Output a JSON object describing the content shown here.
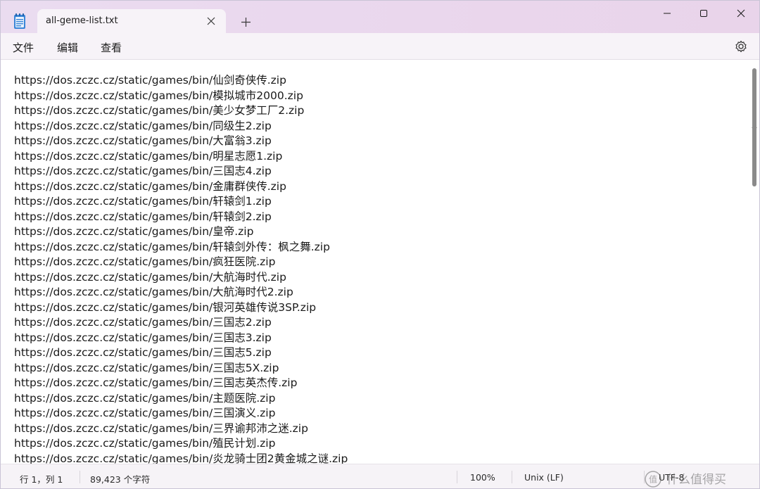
{
  "window": {
    "tab_title": "all-geme-list.txt",
    "new_tab_label": "+"
  },
  "menu": {
    "file": "文件",
    "edit": "编辑",
    "view": "查看"
  },
  "editor": {
    "lines": [
      "https://dos.zczc.cz/static/games/bin/仙剑奇侠传.zip",
      "https://dos.zczc.cz/static/games/bin/模拟城市2000.zip",
      "https://dos.zczc.cz/static/games/bin/美少女梦工厂2.zip",
      "https://dos.zczc.cz/static/games/bin/同级生2.zip",
      "https://dos.zczc.cz/static/games/bin/大富翁3.zip",
      "https://dos.zczc.cz/static/games/bin/明星志愿1.zip",
      "https://dos.zczc.cz/static/games/bin/三国志4.zip",
      "https://dos.zczc.cz/static/games/bin/金庸群侠传.zip",
      "https://dos.zczc.cz/static/games/bin/轩辕剑1.zip",
      "https://dos.zczc.cz/static/games/bin/轩辕剑2.zip",
      "https://dos.zczc.cz/static/games/bin/皇帝.zip",
      "https://dos.zczc.cz/static/games/bin/轩辕剑外传：枫之舞.zip",
      "https://dos.zczc.cz/static/games/bin/疯狂医院.zip",
      "https://dos.zczc.cz/static/games/bin/大航海时代.zip",
      "https://dos.zczc.cz/static/games/bin/大航海时代2.zip",
      "https://dos.zczc.cz/static/games/bin/银河英雄传说3SP.zip",
      "https://dos.zczc.cz/static/games/bin/三国志2.zip",
      "https://dos.zczc.cz/static/games/bin/三国志3.zip",
      "https://dos.zczc.cz/static/games/bin/三国志5.zip",
      "https://dos.zczc.cz/static/games/bin/三国志5X.zip",
      "https://dos.zczc.cz/static/games/bin/三国志英杰传.zip",
      "https://dos.zczc.cz/static/games/bin/主题医院.zip",
      "https://dos.zczc.cz/static/games/bin/三国演义.zip",
      "https://dos.zczc.cz/static/games/bin/三界谕邦沛之迷.zip",
      "https://dos.zczc.cz/static/games/bin/殖民计划.zip",
      "https://dos.zczc.cz/static/games/bin/炎龙骑士团2黄金城之谜.zip"
    ]
  },
  "status": {
    "position": "行 1，列 1",
    "char_count": "89,423 个字符",
    "zoom": "100%",
    "line_ending": "Unix (LF)",
    "encoding": "UTF-8"
  },
  "watermark": "值 什么值得买",
  "icons": {
    "app": "notepad-icon",
    "close_tab": "close-icon",
    "new_tab": "plus-icon",
    "minimize": "minimize-icon",
    "maximize": "maximize-icon",
    "close_window": "close-icon",
    "settings": "gear-icon"
  }
}
